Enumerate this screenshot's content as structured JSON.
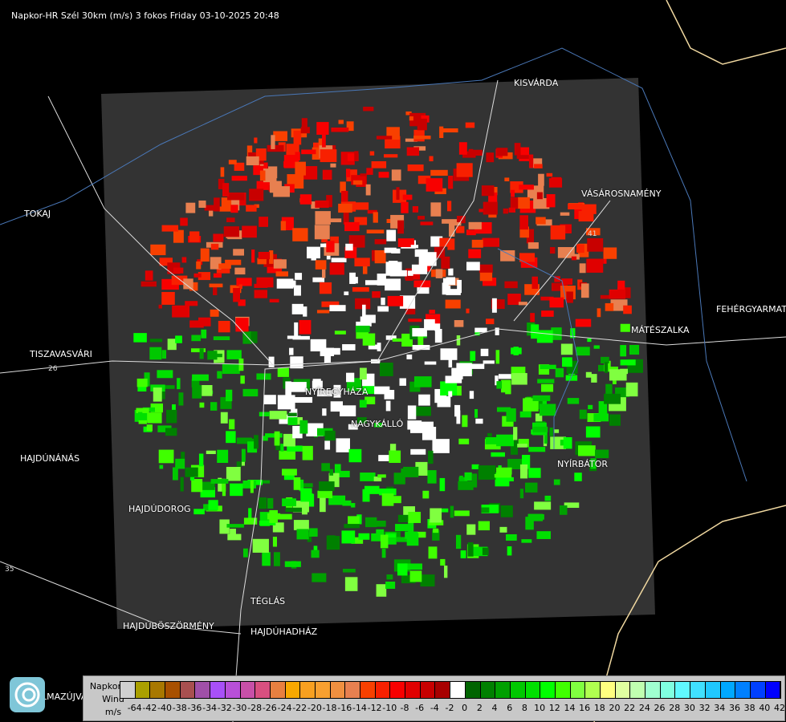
{
  "title": "Napkor-HR Szél 30km (m/s) 3 fokos Friday 03-10-2025 20:48",
  "cities": [
    {
      "name": "KISVÁRDA"
    },
    {
      "name": "VÁSÁROSNAMÉNY"
    },
    {
      "name": "TOKAJ"
    },
    {
      "name": "FEHÉRGYARMAT"
    },
    {
      "name": "MÁTÉSZALKA"
    },
    {
      "name": "TISZAVASVÁRI"
    },
    {
      "name": "NYÍREGYHÁZA"
    },
    {
      "name": "NAGYKÁLLÓ"
    },
    {
      "name": "HAJDÚNÁNÁS"
    },
    {
      "name": "NYÍRBÁTOR"
    },
    {
      "name": "HAJDÚDOROG"
    },
    {
      "name": "TÉGLÁS"
    },
    {
      "name": "HAJDÚBÖSZÖRMÉNY"
    },
    {
      "name": "HAJDÚHADHÁZ"
    },
    {
      "name": "LMAZÚJVÁR"
    }
  ],
  "road_numbers": [
    "26",
    "35",
    "41"
  ],
  "legend": {
    "line1": "Napkor-HR",
    "line2": "Wind",
    "unit": "m/s",
    "colors": [
      "#d0d0d0",
      "#aaa000",
      "#a87800",
      "#a85000",
      "#a85050",
      "#a050a8",
      "#a850f8",
      "#b850d8",
      "#c850a8",
      "#d85080",
      "#e88040",
      "#f8a800",
      "#f8a020",
      "#f8a030",
      "#f09040",
      "#e88050",
      "#f84000",
      "#f82000",
      "#f80000",
      "#e00000",
      "#c80000",
      "#a80000",
      "#ffffff",
      "#006400",
      "#008000",
      "#00a000",
      "#00c800",
      "#00e000",
      "#00ff00",
      "#40ff00",
      "#80ff40",
      "#b0ff50",
      "#ffff80",
      "#e0ffa0",
      "#c0ffb0",
      "#a0ffd0",
      "#80ffe0",
      "#60f8ff",
      "#40e0ff",
      "#20c8ff",
      "#00a8ff",
      "#0080ff",
      "#0040ff",
      "#0000ff"
    ],
    "ticks": [
      "-64",
      "-42",
      "-40",
      "-38",
      "-36",
      "-34",
      "-32",
      "-30",
      "-28",
      "-26",
      "-24",
      "-22",
      "-20",
      "-18",
      "-16",
      "-14",
      "-12",
      "-10",
      "-8",
      "-6",
      "-4",
      "-2",
      "0",
      "2",
      "4",
      "6",
      "8",
      "10",
      "12",
      "14",
      "16",
      "18",
      "20",
      "22",
      "24",
      "26",
      "28",
      "30",
      "32",
      "34",
      "36",
      "38",
      "40",
      "42"
    ]
  }
}
